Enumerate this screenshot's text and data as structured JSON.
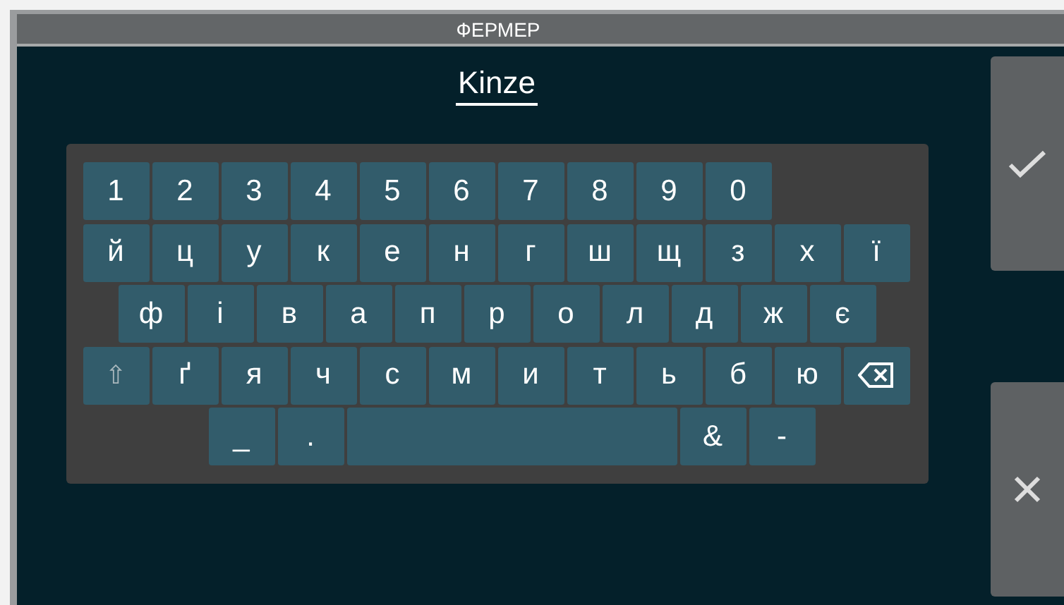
{
  "window": {
    "title": "ФЕРМЕР"
  },
  "input": {
    "value": "Kinze"
  },
  "keyboard": {
    "rows": [
      {
        "kind": "full",
        "keys": [
          {
            "kind": "char",
            "label": "1"
          },
          {
            "kind": "char",
            "label": "2"
          },
          {
            "kind": "char",
            "label": "3"
          },
          {
            "kind": "char",
            "label": "4"
          },
          {
            "kind": "char",
            "label": "5"
          },
          {
            "kind": "char",
            "label": "6"
          },
          {
            "kind": "char",
            "label": "7"
          },
          {
            "kind": "char",
            "label": "8"
          },
          {
            "kind": "char",
            "label": "9"
          },
          {
            "kind": "char",
            "label": "0"
          }
        ]
      },
      {
        "kind": "full",
        "keys": [
          {
            "kind": "char",
            "label": "й"
          },
          {
            "kind": "char",
            "label": "ц"
          },
          {
            "kind": "char",
            "label": "у"
          },
          {
            "kind": "char",
            "label": "к"
          },
          {
            "kind": "char",
            "label": "е"
          },
          {
            "kind": "char",
            "label": "н"
          },
          {
            "kind": "char",
            "label": "г"
          },
          {
            "kind": "char",
            "label": "ш"
          },
          {
            "kind": "char",
            "label": "щ"
          },
          {
            "kind": "char",
            "label": "з"
          },
          {
            "kind": "char",
            "label": "х"
          },
          {
            "kind": "char",
            "label": "ї"
          }
        ]
      },
      {
        "kind": "offset",
        "keys": [
          {
            "kind": "char",
            "label": "ф"
          },
          {
            "kind": "char",
            "label": "і"
          },
          {
            "kind": "char",
            "label": "в"
          },
          {
            "kind": "char",
            "label": "а"
          },
          {
            "kind": "char",
            "label": "п"
          },
          {
            "kind": "char",
            "label": "р"
          },
          {
            "kind": "char",
            "label": "о"
          },
          {
            "kind": "char",
            "label": "л"
          },
          {
            "kind": "char",
            "label": "д"
          },
          {
            "kind": "char",
            "label": "ж"
          },
          {
            "kind": "char",
            "label": "є"
          }
        ]
      },
      {
        "kind": "full",
        "keys": [
          {
            "kind": "shift",
            "label": "⇧"
          },
          {
            "kind": "char",
            "label": "ґ"
          },
          {
            "kind": "char",
            "label": "я"
          },
          {
            "kind": "char",
            "label": "ч"
          },
          {
            "kind": "char",
            "label": "с"
          },
          {
            "kind": "char",
            "label": "м"
          },
          {
            "kind": "char",
            "label": "и"
          },
          {
            "kind": "char",
            "label": "т"
          },
          {
            "kind": "char",
            "label": "ь"
          },
          {
            "kind": "char",
            "label": "б"
          },
          {
            "kind": "char",
            "label": "ю"
          },
          {
            "kind": "backspace"
          }
        ]
      },
      {
        "kind": "bottom",
        "keys": [
          {
            "kind": "char",
            "label": "_"
          },
          {
            "kind": "char",
            "label": "."
          },
          {
            "kind": "space"
          },
          {
            "kind": "char",
            "label": "&"
          },
          {
            "kind": "char",
            "label": "-"
          }
        ]
      }
    ]
  },
  "actions": [
    {
      "kind": "confirm"
    },
    {
      "kind": "cancel"
    }
  ]
}
